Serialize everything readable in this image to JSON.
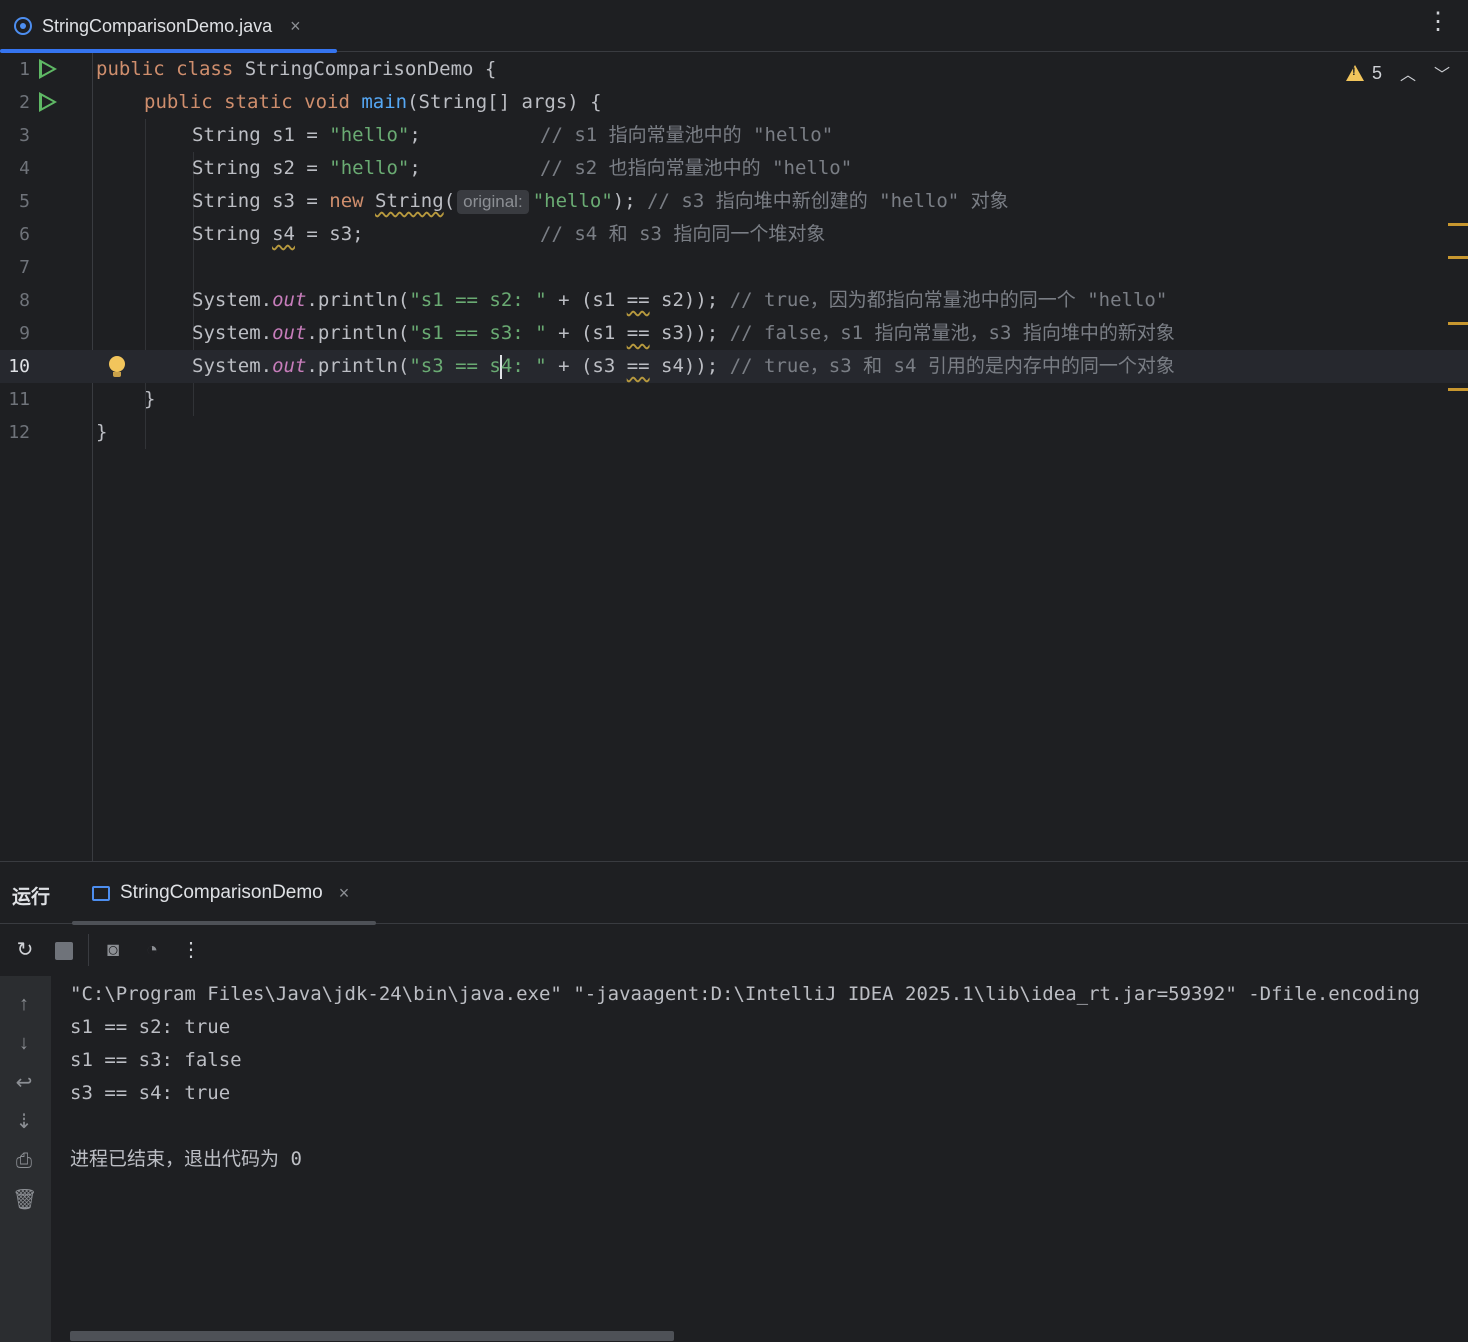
{
  "tab": {
    "file_name": "StringComparisonDemo.java",
    "close": "×"
  },
  "inspection": {
    "warning_count": "5"
  },
  "editor": {
    "lines": [
      {
        "n": "1"
      },
      {
        "n": "2"
      },
      {
        "n": "3"
      },
      {
        "n": "4"
      },
      {
        "n": "5"
      },
      {
        "n": "6"
      },
      {
        "n": "7"
      },
      {
        "n": "8"
      },
      {
        "n": "9"
      },
      {
        "n": "10"
      },
      {
        "n": "11"
      },
      {
        "n": "12"
      }
    ],
    "code": {
      "l1_kw": "public class ",
      "l1_name": "StringComparisonDemo {",
      "l2_kw": "public static void ",
      "l2_fn": "main",
      "l2_rest": "(String[] args) {",
      "l3_a": "String s1 = ",
      "l3_str": "\"hello\"",
      "l3_b": ";",
      "l3_cm": "// s1 指向常量池中的 \"hello\"",
      "l4_a": "String s2 = ",
      "l4_str": "\"hello\"",
      "l4_b": ";",
      "l4_cm": "// s2 也指向常量池中的 \"hello\"",
      "l5_a": "String s3 = ",
      "l5_kw": "new ",
      "l5_cls": "String",
      "l5_paren": "(",
      "l5_hint": "original:",
      "l5_str": "\"hello\"",
      "l5_b": "); ",
      "l5_cm": "// s3 指向堆中新创建的 \"hello\" 对象",
      "l6_a": "String ",
      "l6_var": "s4",
      "l6_b": " = s3;",
      "l6_cm": "// s4 和 s3 指向同一个堆对象",
      "sys": "System.",
      "out": "out",
      "println": ".println(",
      "l8_str": "\"s1 == s2: \"",
      "l8_a": " + (s1 ",
      "eq": "==",
      "l8_b": " s2)); ",
      "l8_cm": "// true，因为都指向常量池中的同一个 \"hello\"",
      "l9_str": "\"s1 == s3: \"",
      "l9_a": " + (s1 ",
      "l9_b": " s3)); ",
      "l9_cm": "// false，s1 指向常量池，s3 指向堆中的新对象",
      "l10_str1": "\"s3 == s",
      "l10_str2": "4: \"",
      "l10_a": " + (s3 ",
      "l10_b": " s4)); ",
      "l10_cm": "// true，s3 和 s4 引用的是内存中的同一个对象",
      "l11": "}",
      "l12": "}"
    }
  },
  "run_panel": {
    "title": "运行",
    "tab_label": "StringComparisonDemo",
    "tab_close": "×",
    "console": [
      "\"C:\\Program Files\\Java\\jdk-24\\bin\\java.exe\" \"-javaagent:D:\\IntelliJ IDEA 2025.1\\lib\\idea_rt.jar=59392\" -Dfile.encoding",
      "s1 == s2: true",
      "s1 == s3: false",
      "s3 == s4: true",
      "",
      "进程已结束，退出代码为 0"
    ]
  },
  "colors": {
    "keyword": "#cf8e6d",
    "string": "#6aab73",
    "comment": "#7a7e85",
    "function": "#56a8f5",
    "field": "#c77dbb",
    "accent": "#3574f0",
    "warning": "#f2c55c"
  },
  "icons": {
    "file": "java-class-icon",
    "run": "run-gutter-icon",
    "bulb": "intention-bulb-icon",
    "warning": "warning-icon",
    "rerun": "rerun-icon",
    "stop": "stop-icon"
  }
}
